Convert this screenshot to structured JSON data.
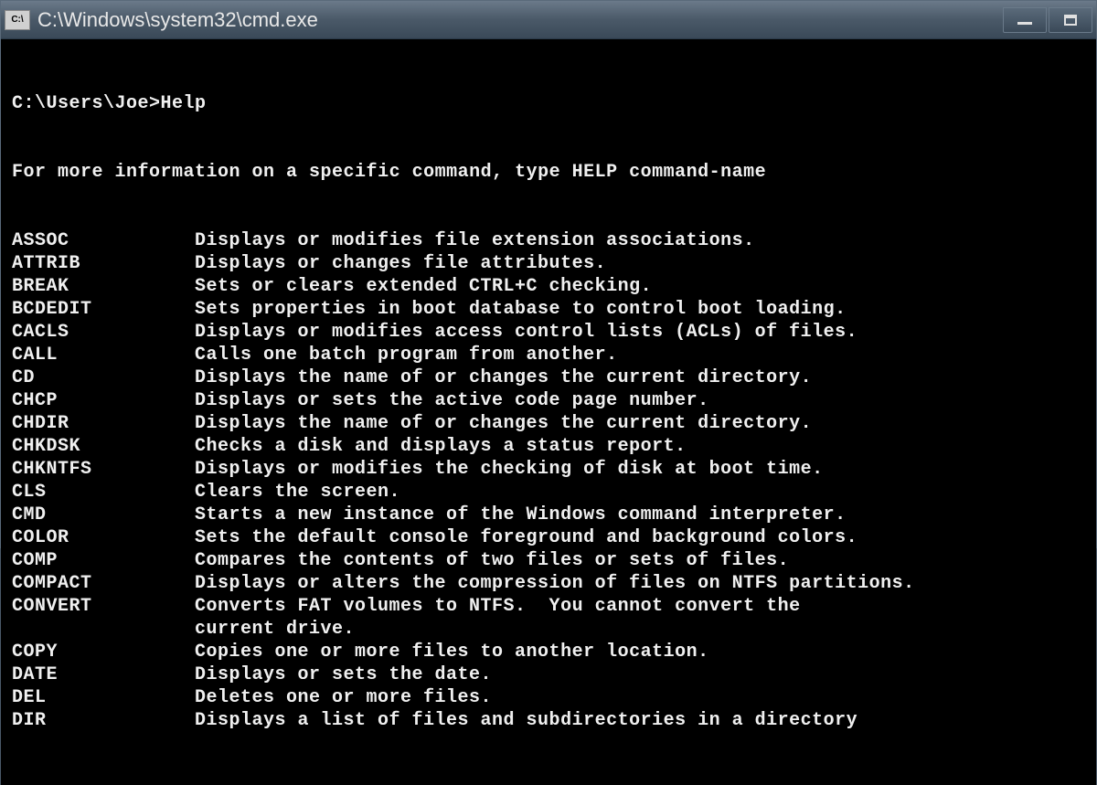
{
  "titlebar": {
    "icon_text": "C:\\",
    "title": "C:\\Windows\\system32\\cmd.exe"
  },
  "terminal": {
    "prompt": "C:\\Users\\Joe>",
    "command": "Help",
    "intro": "For more information on a specific command, type HELP command-name",
    "commands": [
      {
        "name": "ASSOC",
        "desc": "Displays or modifies file extension associations."
      },
      {
        "name": "ATTRIB",
        "desc": "Displays or changes file attributes."
      },
      {
        "name": "BREAK",
        "desc": "Sets or clears extended CTRL+C checking."
      },
      {
        "name": "BCDEDIT",
        "desc": "Sets properties in boot database to control boot loading."
      },
      {
        "name": "CACLS",
        "desc": "Displays or modifies access control lists (ACLs) of files."
      },
      {
        "name": "CALL",
        "desc": "Calls one batch program from another."
      },
      {
        "name": "CD",
        "desc": "Displays the name of or changes the current directory."
      },
      {
        "name": "CHCP",
        "desc": "Displays or sets the active code page number."
      },
      {
        "name": "CHDIR",
        "desc": "Displays the name of or changes the current directory."
      },
      {
        "name": "CHKDSK",
        "desc": "Checks a disk and displays a status report."
      },
      {
        "name": "CHKNTFS",
        "desc": "Displays or modifies the checking of disk at boot time."
      },
      {
        "name": "CLS",
        "desc": "Clears the screen."
      },
      {
        "name": "CMD",
        "desc": "Starts a new instance of the Windows command interpreter."
      },
      {
        "name": "COLOR",
        "desc": "Sets the default console foreground and background colors."
      },
      {
        "name": "COMP",
        "desc": "Compares the contents of two files or sets of files."
      },
      {
        "name": "COMPACT",
        "desc": "Displays or alters the compression of files on NTFS partitions."
      },
      {
        "name": "CONVERT",
        "desc": "Converts FAT volumes to NTFS.  You cannot convert the\ncurrent drive."
      },
      {
        "name": "COPY",
        "desc": "Copies one or more files to another location."
      },
      {
        "name": "DATE",
        "desc": "Displays or sets the date."
      },
      {
        "name": "DEL",
        "desc": "Deletes one or more files."
      },
      {
        "name": "DIR",
        "desc": "Displays a list of files and subdirectories in a directory"
      }
    ]
  }
}
